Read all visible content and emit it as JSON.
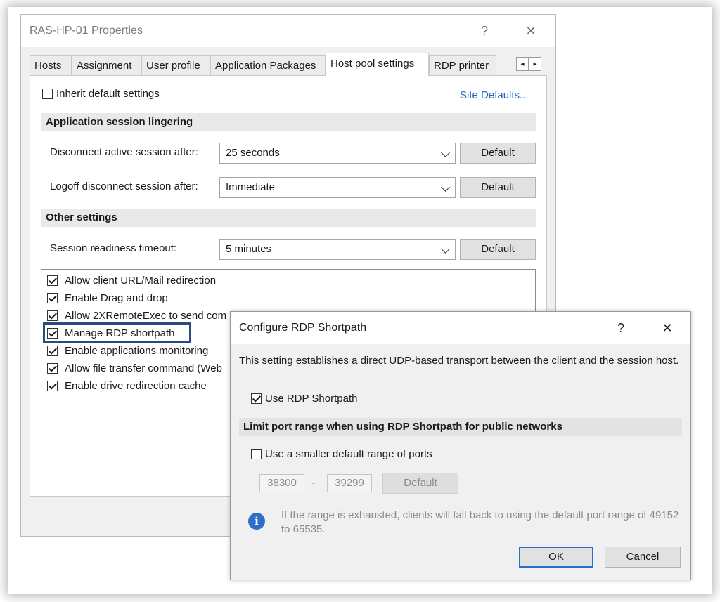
{
  "main_window": {
    "title": "RAS-HP-01 Properties",
    "help": "?",
    "close": "✕",
    "tabs": [
      {
        "label": "Hosts"
      },
      {
        "label": "Assignment"
      },
      {
        "label": "User profile"
      },
      {
        "label": "Application Packages"
      },
      {
        "label": "Host pool settings",
        "active": true
      },
      {
        "label": "RDP printer"
      }
    ],
    "scroll_left": "◂",
    "scroll_right": "▸",
    "inherit_label": "Inherit default settings",
    "inherit_checked": false,
    "site_defaults": "Site Defaults...",
    "section_lingering": "Application session lingering",
    "disconnect_label": "Disconnect active session after:",
    "disconnect_value": "25 seconds",
    "logoff_label": "Logoff disconnect session after:",
    "logoff_value": "Immediate",
    "section_other": "Other settings",
    "readiness_label": "Session readiness timeout:",
    "readiness_value": "5 minutes",
    "default_label": "Default",
    "options": [
      {
        "label": "Allow client URL/Mail redirection",
        "checked": true
      },
      {
        "label": "Enable Drag and drop",
        "checked": true
      },
      {
        "label": "Allow 2XRemoteExec to send com",
        "checked": true
      },
      {
        "label": "Manage RDP shortpath",
        "checked": true
      },
      {
        "label": "Enable applications monitoring",
        "checked": true
      },
      {
        "label": "Allow file transfer command (Web",
        "checked": true
      },
      {
        "label": "Enable drive redirection cache",
        "checked": true
      }
    ]
  },
  "dialog": {
    "title": "Configure RDP Shortpath",
    "help": "?",
    "close": "✕",
    "description": "This setting establishes a direct UDP-based transport between the client and the session host.",
    "use_shortpath_label": "Use RDP Shortpath",
    "use_shortpath_checked": true,
    "section_limit": "Limit port range when using RDP Shortpath for public networks",
    "smaller_range_label": "Use a smaller default range of ports",
    "smaller_range_checked": false,
    "port_from": "38300",
    "port_sep": "-",
    "port_to": "39299",
    "default_label": "Default",
    "info_icon": "i",
    "info_text": "If the range is exhausted, clients will fall back to using the default port range of 49152 to 65535.",
    "ok_label": "OK",
    "cancel_label": "Cancel"
  },
  "colors": {
    "link": "#1f63c2",
    "highlight_border": "#2a4a82",
    "primary_button_border": "#2a6fcf",
    "info_icon": "#2e6ec6"
  }
}
